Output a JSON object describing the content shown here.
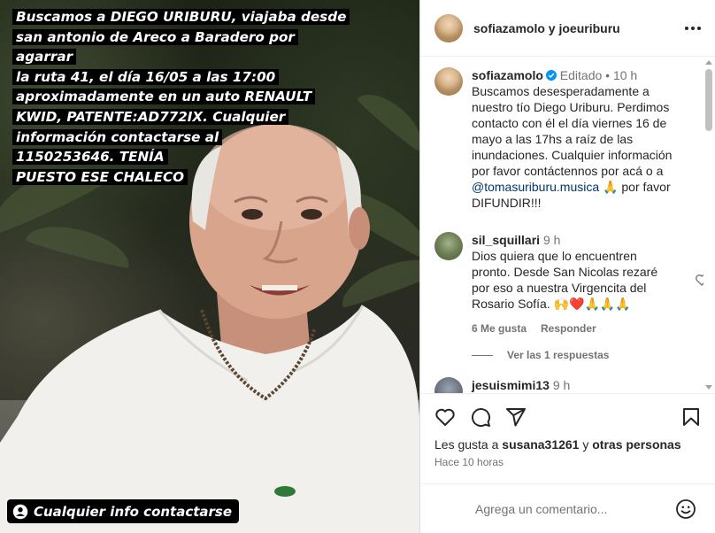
{
  "media": {
    "caption_lines": [
      "Buscamos a DIEGO URIBURU, viajaba desde",
      "san antonio de Areco a Baradero por agarrar",
      "la ruta 41, el día 16/05 a las 17:00",
      "aproximadamente en un auto RENAULT",
      "KWID, PATENTE:AD772IX. Cualquier",
      "información contactarse al",
      "1150253646. TENÍA",
      "PUESTO ESE CHALECO"
    ],
    "bottom_text": "Cualquier info contactarse"
  },
  "header": {
    "user1": "sofiazamolo",
    "connector": " y ",
    "user2": "joeuriburu",
    "more_icon": "more-horizontal-icon"
  },
  "caption_comment": {
    "username": "sofiazamolo",
    "edited": "Editado",
    "dot": "•",
    "time": "10 h",
    "text_before": "Buscamos desesperadamente a nuestro tío Diego Uriburu. Perdimos contacto con él el día viernes 16 de mayo a las 17hs a raíz de las inundaciones. Cualquier información por favor contáctennos por acá o a ",
    "mention": "@tomasuriburu.musica",
    "text_after": " 🙏 por favor DIFUNDIR!!!"
  },
  "comments": [
    {
      "username": "sil_squillari",
      "time": "9 h",
      "text": "Dios quiera que lo encuentren pronto. Desde San Nicolas rezaré por eso a nuestra Virgencita del Rosario Sofía. 🙌❤️🙏🙏🙏",
      "likes": "6 Me gusta",
      "reply": "Responder",
      "view_replies": "Ver las 1 respuestas"
    },
    {
      "username": "jesuismimi13",
      "time": "9 h"
    }
  ],
  "actions": {
    "likes_prefix": "Les gusta a ",
    "liked_by": "susana31261",
    "likes_connector": " y ",
    "others": "otras personas",
    "time_ago": "Hace 10 horas"
  },
  "add_comment": {
    "placeholder": "Agrega un comentario..."
  },
  "colors": {
    "text": "#262626",
    "secondary": "#737373",
    "link": "#00376b",
    "verified": "#0095f6",
    "heart_red": "#ed4956"
  }
}
